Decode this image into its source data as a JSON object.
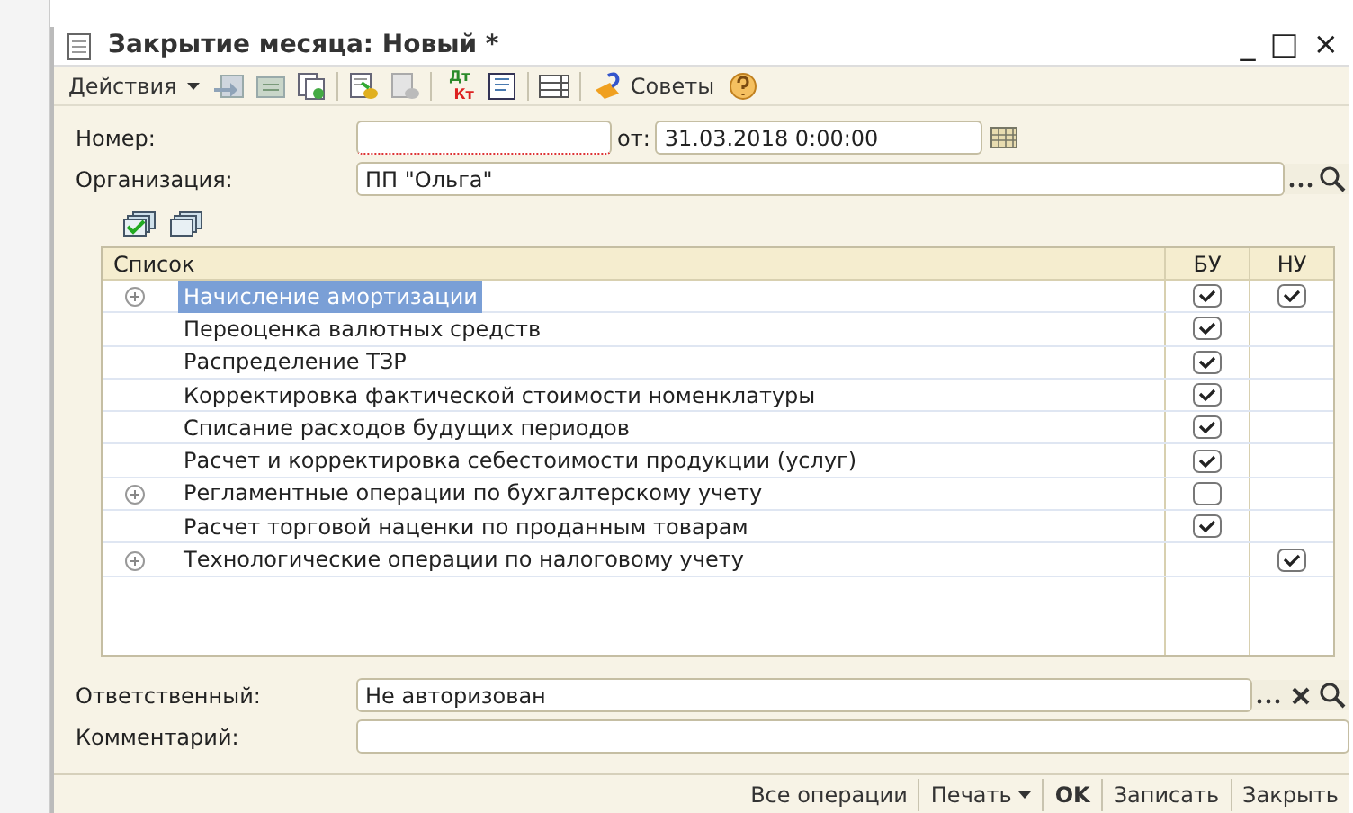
{
  "window": {
    "title": "Закрытие месяца: Новый *",
    "controls": [
      "_",
      "□",
      "×"
    ]
  },
  "toolbar": [
    {
      "kind": "menu",
      "label": "Действия"
    },
    {
      "kind": "icon"
    },
    {
      "kind": "icon"
    },
    {
      "kind": "icon"
    },
    {
      "kind": "sep"
    },
    {
      "kind": "icon"
    },
    {
      "kind": "icon"
    },
    {
      "kind": "sep"
    },
    {
      "kind": "dtkt",
      "labels": [
        "Дт",
        "Кт"
      ]
    },
    {
      "kind": "icon"
    },
    {
      "kind": "sep"
    },
    {
      "kind": "icon"
    },
    {
      "kind": "sep"
    },
    {
      "kind": "tips",
      "label": "Советы"
    },
    {
      "kind": "help"
    }
  ],
  "fields": {
    "number_label": "Номер:",
    "date_label": "от:",
    "date_value": "31.03.2018  0:00:00",
    "org_label": "Организация:",
    "org_value": "ПП \"Ольга\""
  },
  "table": {
    "columns": [
      "Список",
      "БУ",
      "НУ"
    ],
    "rows": [
      {
        "name": "Начисление амортизации",
        "expandable": true,
        "selected": true,
        "bu_checked": true,
        "nu_checked": true
      },
      {
        "name": "Переоценка валютных средств",
        "expandable": false,
        "selected": false,
        "bu_checked": true
      },
      {
        "name": "Распределение ТЗР",
        "expandable": false,
        "selected": false,
        "bu_checked": true
      },
      {
        "name": "Корректировка фактической стоимости номенклатуры",
        "expandable": false,
        "selected": false,
        "bu_checked": true
      },
      {
        "name": "Списание расходов будущих периодов",
        "expandable": false,
        "selected": false,
        "bu_checked": true
      },
      {
        "name": "Расчет и корректировка себестоимости продукции (услуг)",
        "expandable": false,
        "selected": false,
        "bu_checked": true
      },
      {
        "name": "Регламентные операции по бухгалтерскому учету",
        "expandable": true,
        "selected": false,
        "bu_checked": false
      },
      {
        "name": "Расчет торговой наценки по проданным товарам",
        "expandable": false,
        "selected": false,
        "bu_checked": true
      },
      {
        "name": "Технологические операции по налоговому учету",
        "expandable": true,
        "selected": false,
        "nu_checked": true
      }
    ]
  },
  "responsible": {
    "label": "Ответственный:",
    "value": "Не авторизован"
  },
  "comment": {
    "label": "Комментарий:"
  },
  "footer": [
    {
      "label": "Все операции",
      "kind": "plain"
    },
    {
      "label": "Печать",
      "kind": "menu"
    },
    {
      "label": "OK",
      "kind": "default"
    },
    {
      "label": "Записать",
      "kind": "plain"
    },
    {
      "label": "Закрыть",
      "kind": "plain"
    }
  ]
}
